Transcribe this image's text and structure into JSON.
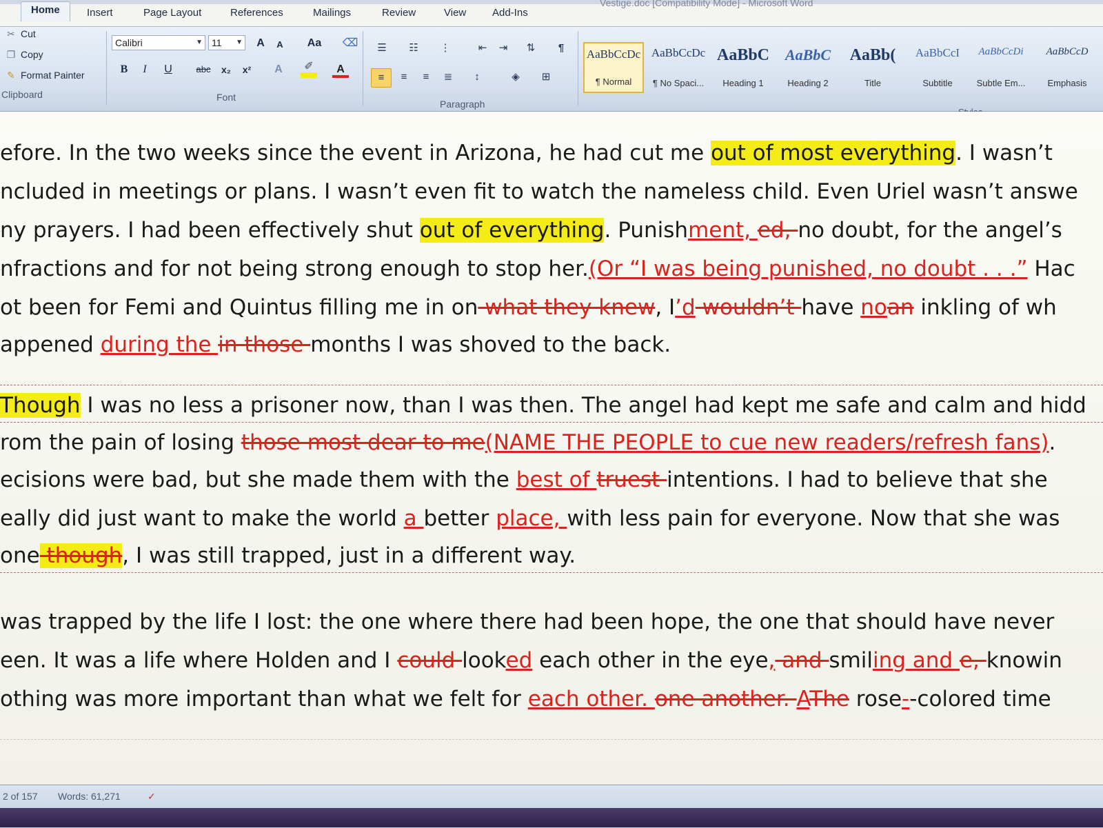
{
  "window": {
    "title": "Vestige.doc [Compatibility Mode] - Microsoft Word"
  },
  "tabs": [
    "Home",
    "Insert",
    "Page Layout",
    "References",
    "Mailings",
    "Review",
    "View",
    "Add-Ins"
  ],
  "clipboard": {
    "cut": "Cut",
    "copy": "Copy",
    "format_painter": "Format Painter",
    "label": "Clipboard"
  },
  "font": {
    "name": "Calibri",
    "size": "11",
    "label": "Font",
    "bold": "B",
    "italic": "I",
    "underline": "U",
    "strike": "abc",
    "subscript": "x₂",
    "superscript": "x²",
    "grow": "A",
    "shrink": "A",
    "case": "Aa",
    "font_color": "A"
  },
  "paragraph": {
    "label": "Paragraph",
    "pilcrow": "¶"
  },
  "styles": {
    "label": "Styles",
    "items": [
      {
        "preview": "AaBbCcDc",
        "name": "¶ Normal"
      },
      {
        "preview": "AaBbCcDc",
        "name": "¶ No Spaci..."
      },
      {
        "preview": "AaBbC",
        "name": "Heading 1"
      },
      {
        "preview": "AaBbC",
        "name": "Heading 2"
      },
      {
        "preview": "AaBb(",
        "name": "Title"
      },
      {
        "preview": "AaBbCcI",
        "name": "Subtitle"
      },
      {
        "preview": "AaBbCcDi",
        "name": "Subtle Em..."
      },
      {
        "preview": "AaBbCcD",
        "name": "Emphasis"
      }
    ]
  },
  "document": {
    "lines": [
      [
        [
          "n",
          "efore. In the two weeks since the event in Arizona, he had cut me "
        ],
        [
          "h",
          "out of most everything"
        ],
        [
          "n",
          ". I wasn’t"
        ]
      ],
      [
        [
          "n",
          "ncluded in meetings or plans. I wasn’t even fit to watch the nameless child. Even Uriel wasn’t answe"
        ]
      ],
      [
        [
          "n",
          "ny prayers. I had been effectively shut "
        ],
        [
          "h",
          "out of everything"
        ],
        [
          "n",
          ". Punish"
        ],
        [
          "i",
          "ment, "
        ],
        [
          "d",
          "ed, "
        ],
        [
          "n",
          "no doubt, for the angel’s"
        ]
      ],
      [
        [
          "n",
          "nfractions and for not being strong enough to stop her."
        ],
        [
          "i",
          "(Or “I was being punished, no doubt . . .”"
        ],
        [
          "n",
          " Hac"
        ]
      ],
      [
        [
          "n",
          "ot been for Femi and Quintus filling me in on"
        ],
        [
          "d",
          " what they knew"
        ],
        [
          "n",
          ", I"
        ],
        [
          "i",
          "’d"
        ],
        [
          "d",
          " wouldn’t "
        ],
        [
          "n",
          "have "
        ],
        [
          "i",
          "no"
        ],
        [
          "d",
          "an"
        ],
        [
          "n",
          " inkling of wh"
        ]
      ],
      [
        [
          "n",
          "appened "
        ],
        [
          "i",
          "during the "
        ],
        [
          "d",
          "in those "
        ],
        [
          "n",
          "months I was shoved to the back."
        ]
      ],
      [
        [
          "h",
          "Though"
        ],
        [
          "n",
          " I was no less a prisoner now, than I was then. The angel had kept me safe and calm and hidd"
        ]
      ],
      [
        [
          "n",
          "rom the pain of losing "
        ],
        [
          "d",
          "those most dear to me"
        ],
        [
          "i",
          "(NAME THE PEOPLE to cue new readers/refresh  fans)"
        ],
        [
          "n",
          "."
        ]
      ],
      [
        [
          "n",
          "ecisions were bad, but she made them with the "
        ],
        [
          "i",
          "best of "
        ],
        [
          "d",
          "truest "
        ],
        [
          "n",
          "intentions. I had to believe that she"
        ]
      ],
      [
        [
          "n",
          "eally did just want to make the world "
        ],
        [
          "i",
          "a "
        ],
        [
          "n",
          "better "
        ],
        [
          "i",
          "place, "
        ],
        [
          "n",
          "with less pain for everyone.  Now that she was"
        ]
      ],
      [
        [
          "n",
          "one"
        ],
        [
          "dh",
          " though"
        ],
        [
          "n",
          ", I was still trapped, just in a different way."
        ]
      ],
      [
        [
          "n",
          "was trapped by the life I lost: the one where there had been hope, the one that should have never"
        ]
      ],
      [
        [
          "n",
          "een. It was a life where Holden and I "
        ],
        [
          "d",
          "could "
        ],
        [
          "n",
          "look"
        ],
        [
          "i",
          "ed"
        ],
        [
          "n",
          " each other in the eye"
        ],
        [
          "i",
          ","
        ],
        [
          "d",
          " and "
        ],
        [
          "n",
          "smil"
        ],
        [
          "i",
          "ing and "
        ],
        [
          "d",
          "e, "
        ],
        [
          "n",
          "knowin"
        ]
      ],
      [
        [
          "n",
          "othing was more important than what we felt for "
        ],
        [
          "i",
          "each other. "
        ],
        [
          "d",
          "one another. "
        ],
        [
          "i",
          "A"
        ],
        [
          "d",
          "The"
        ],
        [
          "n",
          " rose"
        ],
        [
          "i",
          "-"
        ],
        [
          "n",
          "-colored time"
        ]
      ]
    ]
  },
  "status": {
    "page": "2 of 157",
    "words": "Words: 61,271"
  },
  "colors": {
    "highlight": "#f4ec17",
    "revision": "#d9231c",
    "selected_style": "#fdf3c8"
  }
}
